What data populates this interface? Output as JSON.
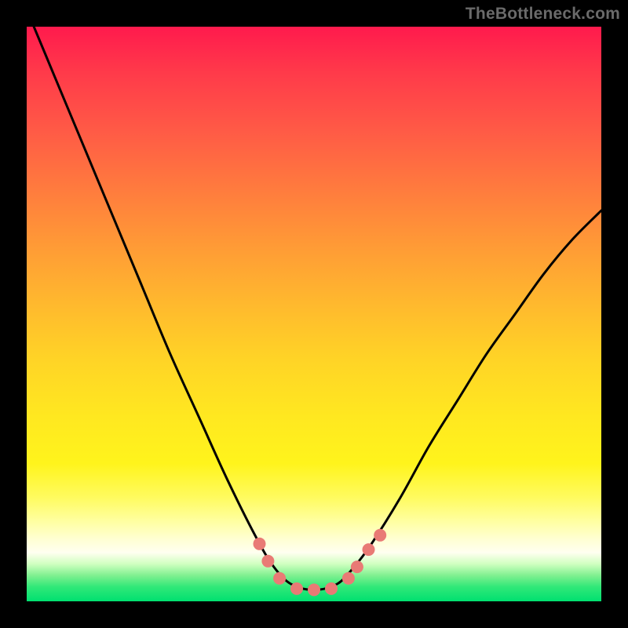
{
  "watermark": "TheBottleneck.com",
  "chart_data": {
    "type": "line",
    "title": "",
    "xlabel": "",
    "ylabel": "",
    "xlim": [
      0,
      1
    ],
    "ylim": [
      0,
      1
    ],
    "series": [
      {
        "name": "bottleneck-curve",
        "x": [
          0.0,
          0.05,
          0.1,
          0.15,
          0.2,
          0.25,
          0.3,
          0.35,
          0.4,
          0.43,
          0.46,
          0.5,
          0.54,
          0.57,
          0.6,
          0.65,
          0.7,
          0.75,
          0.8,
          0.85,
          0.9,
          0.95,
          1.0
        ],
        "y": [
          1.03,
          0.91,
          0.79,
          0.67,
          0.55,
          0.43,
          0.32,
          0.21,
          0.11,
          0.06,
          0.03,
          0.02,
          0.03,
          0.06,
          0.1,
          0.18,
          0.27,
          0.35,
          0.43,
          0.5,
          0.57,
          0.63,
          0.68
        ]
      }
    ],
    "markers": {
      "name": "highlight-dots",
      "color": "#e97a75",
      "x": [
        0.405,
        0.42,
        0.44,
        0.47,
        0.5,
        0.53,
        0.56,
        0.575,
        0.595,
        0.615
      ],
      "y": [
        0.1,
        0.07,
        0.04,
        0.022,
        0.02,
        0.022,
        0.04,
        0.06,
        0.09,
        0.115
      ]
    }
  }
}
